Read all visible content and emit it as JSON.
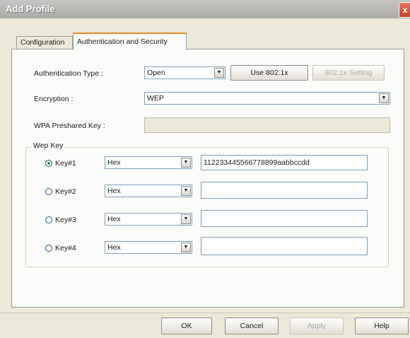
{
  "window": {
    "title": "Add Profile",
    "close_label": "x"
  },
  "tabs": [
    {
      "label": "Configuration",
      "active": false
    },
    {
      "label": "Authentication and Security",
      "active": true
    }
  ],
  "form": {
    "auth_type": {
      "label": "Authentication Type :",
      "value": "Open",
      "use_8021x_label": "Use 802.1x",
      "setting_8021x_label": "802.1x Setting"
    },
    "encryption": {
      "label": "Encryption :",
      "value": "WEP"
    },
    "wpa_psk": {
      "label": "WPA Preshared Key :",
      "value": ""
    }
  },
  "wep": {
    "group_label": "Wep Key",
    "keys": [
      {
        "label": "Key#1",
        "selected": true,
        "format": "Hex",
        "value": "112233445566778899aabbccdd"
      },
      {
        "label": "Key#2",
        "selected": false,
        "format": "Hex",
        "value": ""
      },
      {
        "label": "Key#3",
        "selected": false,
        "format": "Hex",
        "value": ""
      },
      {
        "label": "Key#4",
        "selected": false,
        "format": "Hex",
        "value": ""
      }
    ]
  },
  "buttons": {
    "ok": "OK",
    "cancel": "Cancel",
    "apply": "Apply",
    "help": "Help"
  },
  "icons": {
    "dropdown_arrow": "▼"
  },
  "colors": {
    "dialog_bg": "#ece9d8",
    "panel_bg": "#fbfbf9",
    "field_border": "#7f9db9",
    "tab_highlight": "#e68b2c"
  }
}
